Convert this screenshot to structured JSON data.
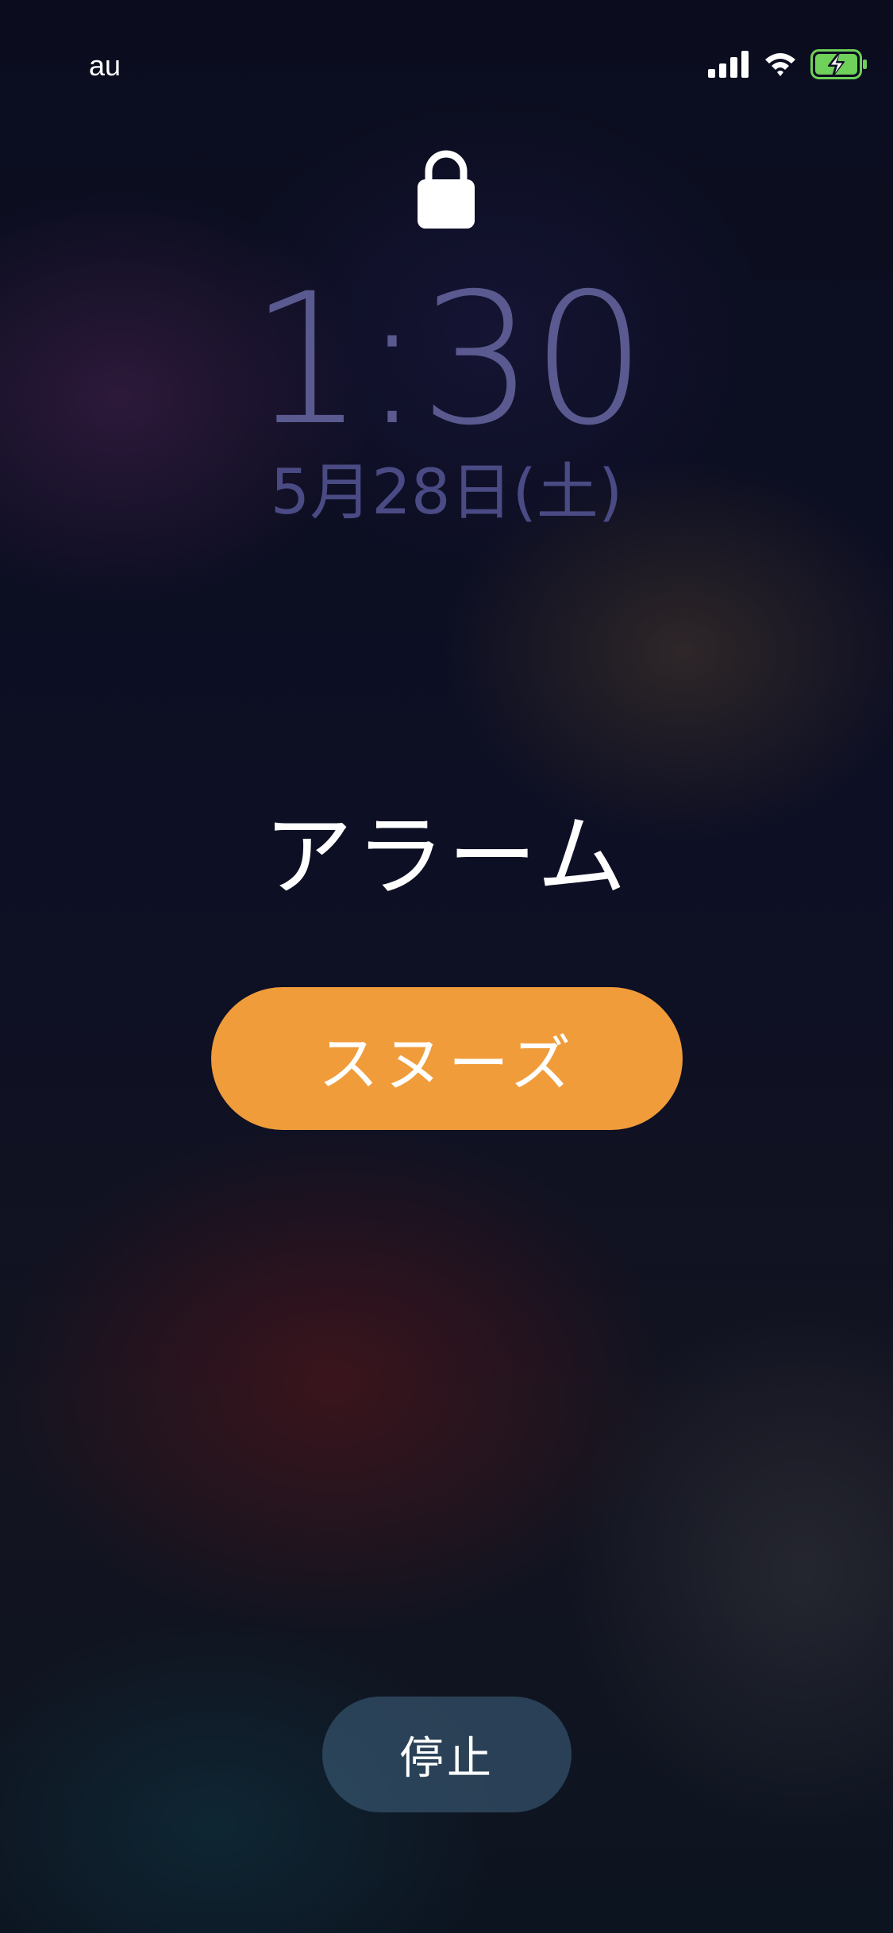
{
  "status_bar": {
    "carrier": "au",
    "signal_icon": "cellular-signal-icon",
    "wifi_icon": "wifi-icon",
    "battery_icon": "battery-charging-icon",
    "battery_color": "#6fd05a"
  },
  "lock_screen": {
    "lock_icon": "lock-icon",
    "time": "1:30",
    "date": "5月28日(土)"
  },
  "alarm": {
    "title": "アラーム",
    "snooze_label": "スヌーズ",
    "stop_label": "停止"
  },
  "colors": {
    "snooze_button": "#f09c3a",
    "stop_button": "#3c5c78"
  }
}
